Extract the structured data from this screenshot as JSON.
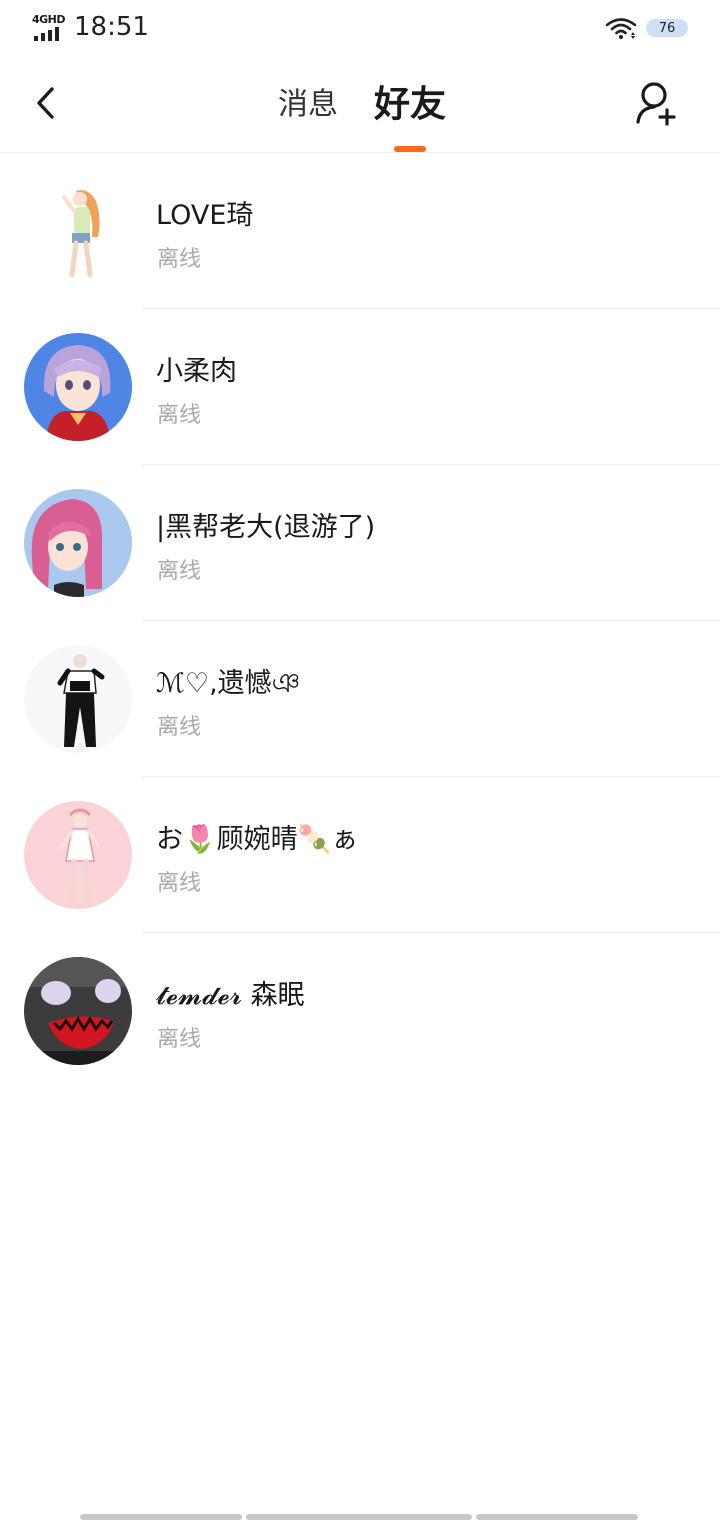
{
  "status_bar": {
    "network": "4GHD",
    "time": "18:51",
    "battery": "76"
  },
  "header": {
    "back_icon": "chevron-left-icon",
    "tabs": [
      {
        "label": "消息",
        "active": false
      },
      {
        "label": "好友",
        "active": true
      }
    ],
    "accent_color": "#ff6a1a",
    "add_friend_icon": "add-user-icon"
  },
  "friends": [
    {
      "name": "LOVE琦",
      "status": "离线",
      "avatar": "anime-girl-orange-hair"
    },
    {
      "name": "小柔肉",
      "status": "离线",
      "avatar": "anime-girl-lavender-hair"
    },
    {
      "name": "|黑帮老大(退游了)",
      "status": "离线",
      "avatar": "anime-girl-pink-hair"
    },
    {
      "name": "ℳ♡,遗憾ঞ",
      "status": "离线",
      "avatar": "anime-figure-black-outfit"
    },
    {
      "name": "お🌷顾婉晴🍡ぁ",
      "status": "离线",
      "avatar": "anime-figure-pink-background"
    },
    {
      "name": "𝓽𝓮𝓶𝓭𝓮𝓻 森眠",
      "status": "离线",
      "avatar": "grinning-monster-face"
    }
  ]
}
